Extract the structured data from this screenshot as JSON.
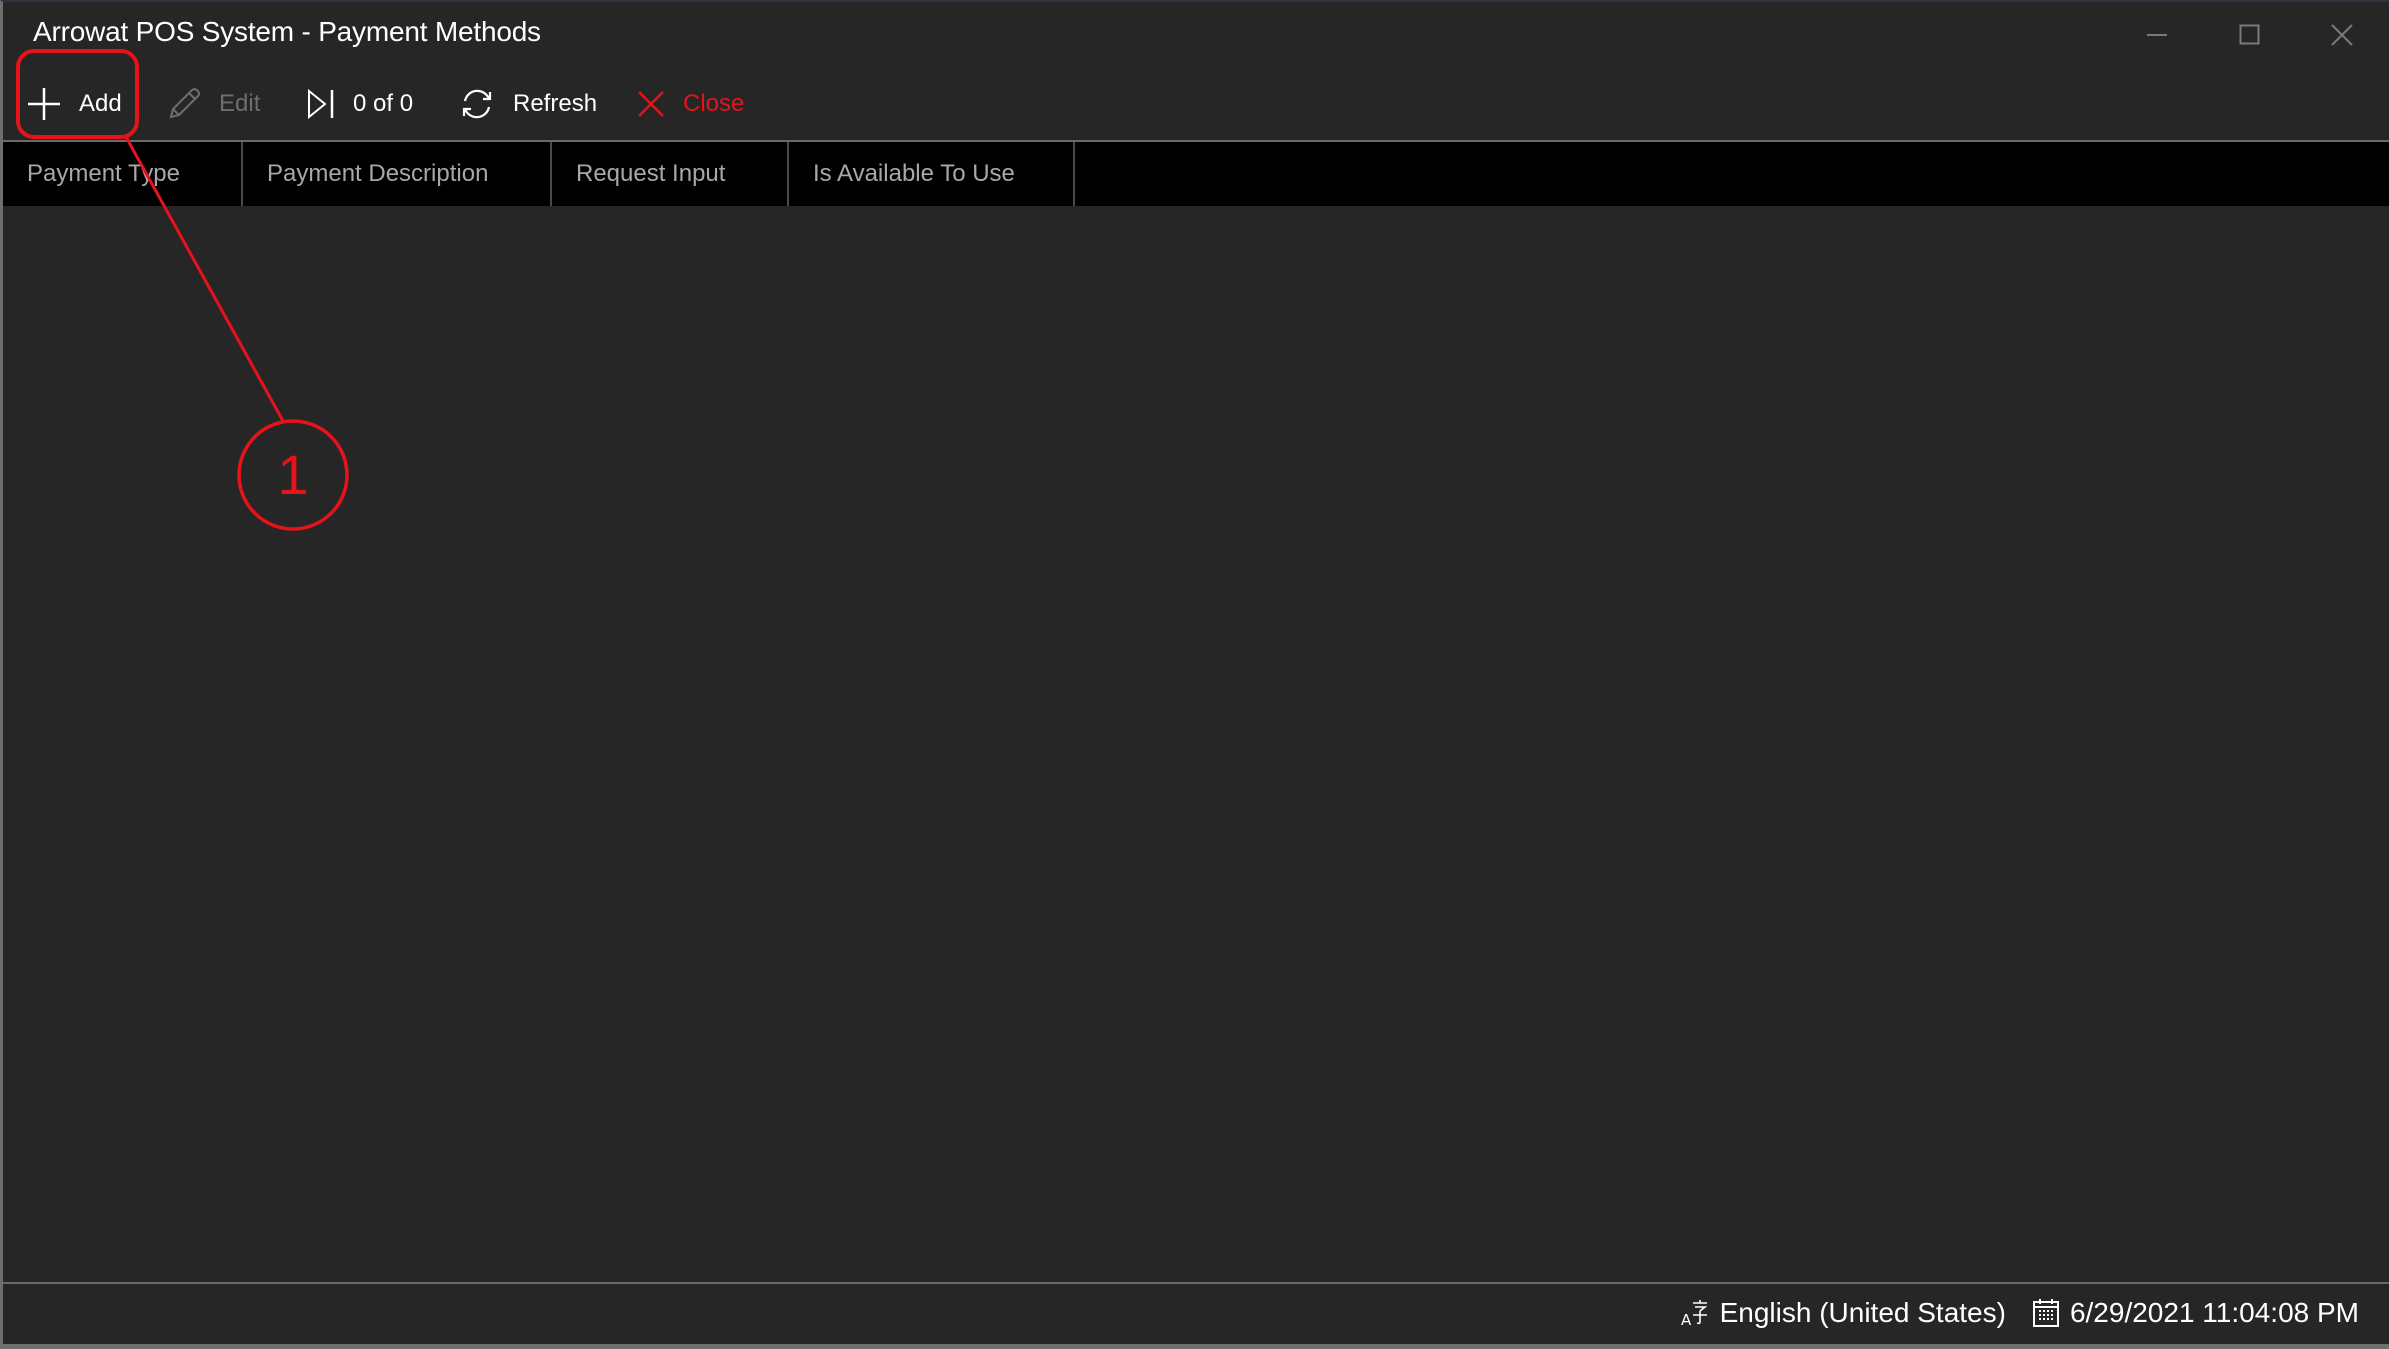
{
  "window": {
    "title": "Arrowat POS System - Payment Methods",
    "controls": {
      "minimize": "minimize-icon",
      "maximize": "maximize-icon",
      "close": "close-icon"
    }
  },
  "toolbar": {
    "add": {
      "label": "Add",
      "icon": "plus-icon",
      "enabled": true
    },
    "edit": {
      "label": "Edit",
      "icon": "pencil-icon",
      "enabled": false
    },
    "navigation": {
      "label": "0 of 0",
      "icon": "skip-next-icon"
    },
    "refresh": {
      "label": "Refresh",
      "icon": "refresh-icon"
    },
    "close": {
      "label": "Close",
      "icon": "close-x-icon"
    }
  },
  "grid": {
    "columns": [
      "Payment Type",
      "Payment Description",
      "Request Input",
      "Is Available To Use"
    ],
    "rows": []
  },
  "statusbar": {
    "language": {
      "label": "English (United States)",
      "icon": "language-icon"
    },
    "datetime": {
      "label": "6/29/2021 11:04:08 PM",
      "icon": "calendar-icon"
    }
  },
  "annotation": {
    "number": "1",
    "target": "Add",
    "color": "#e8121b"
  },
  "colors": {
    "background": "#262626",
    "header_background": "#000000",
    "close_accent": "#e8121b",
    "disabled_text": "#6e6e6e"
  }
}
